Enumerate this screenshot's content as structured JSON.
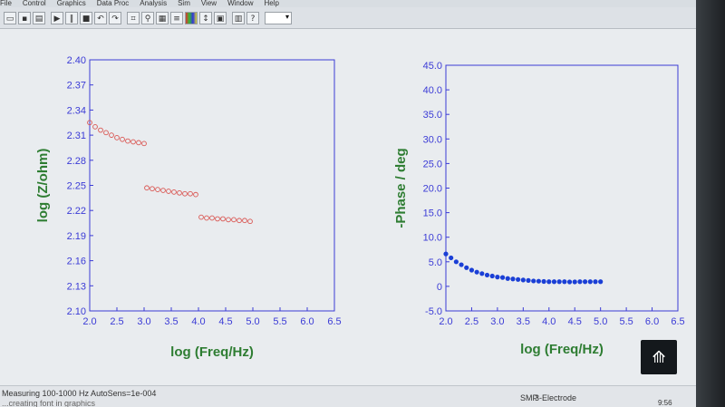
{
  "menu": [
    "File",
    "Control",
    "Graphics",
    "Data Proc",
    "Analysis",
    "Sim",
    "View",
    "Window",
    "Help"
  ],
  "toolbar": {
    "icons": [
      "open-icon",
      "save-icon",
      "print-icon",
      "run-icon",
      "pause-icon",
      "stop-icon",
      "reverse-icon",
      "forward-icon",
      "graph-icon",
      "zoom-icon",
      "chart-icon",
      "overlay-icon",
      "color-bars-icon",
      "axis-icon",
      "settings-icon",
      "grid-icon",
      "help-icon"
    ]
  },
  "chart_data": [
    {
      "type": "scatter",
      "xlabel": "log (Freq/Hz)",
      "ylabel": "log (Z/ohm)",
      "xlim": [
        2.0,
        6.5
      ],
      "ylim": [
        2.1,
        2.4
      ],
      "xticks": [
        "2.0",
        "2.5",
        "3.0",
        "3.5",
        "4.0",
        "4.5",
        "5.0",
        "5.5",
        "6.0",
        "6.5"
      ],
      "yticks": [
        "2.10",
        "2.13",
        "2.16",
        "2.19",
        "2.22",
        "2.25",
        "2.28",
        "2.31",
        "2.34",
        "2.37",
        "2.40"
      ],
      "grid": false,
      "marker": "open-circle",
      "color": "#d9534f",
      "axis_color": "#3b3bd6",
      "label_color": "#2e7d32",
      "x": [
        2.0,
        2.1,
        2.2,
        2.3,
        2.4,
        2.5,
        2.6,
        2.7,
        2.8,
        2.9,
        3.0,
        3.05,
        3.15,
        3.25,
        3.35,
        3.45,
        3.55,
        3.65,
        3.75,
        3.85,
        3.95,
        4.05,
        4.15,
        4.25,
        4.35,
        4.45,
        4.55,
        4.65,
        4.75,
        4.85,
        4.95
      ],
      "y": [
        2.325,
        2.32,
        2.316,
        2.313,
        2.31,
        2.307,
        2.305,
        2.303,
        2.302,
        2.301,
        2.3,
        2.247,
        2.246,
        2.245,
        2.244,
        2.243,
        2.242,
        2.241,
        2.24,
        2.24,
        2.239,
        2.212,
        2.211,
        2.211,
        2.21,
        2.21,
        2.209,
        2.209,
        2.208,
        2.208,
        2.207
      ]
    },
    {
      "type": "scatter",
      "xlabel": "log (Freq/Hz)",
      "ylabel": "-Phase / deg",
      "xlim": [
        2.0,
        6.5
      ],
      "ylim": [
        -5.0,
        45.0
      ],
      "xticks": [
        "2.0",
        "2.5",
        "3.0",
        "3.5",
        "4.0",
        "4.5",
        "5.0",
        "5.5",
        "6.0",
        "6.5"
      ],
      "yticks": [
        "-5.0",
        "0",
        "5.0",
        "10.0",
        "15.0",
        "20.0",
        "25.0",
        "30.0",
        "35.0",
        "40.0",
        "45.0"
      ],
      "grid": false,
      "marker": "filled-circle",
      "color": "#1a3fd6",
      "axis_color": "#3b3bd6",
      "label_color": "#2e7d32",
      "x": [
        2.0,
        2.1,
        2.2,
        2.3,
        2.4,
        2.5,
        2.6,
        2.7,
        2.8,
        2.9,
        3.0,
        3.1,
        3.2,
        3.3,
        3.4,
        3.5,
        3.6,
        3.7,
        3.8,
        3.9,
        4.0,
        4.1,
        4.2,
        4.3,
        4.4,
        4.5,
        4.6,
        4.7,
        4.8,
        4.9,
        5.0
      ],
      "y": [
        6.6,
        5.8,
        5.0,
        4.4,
        3.8,
        3.3,
        2.9,
        2.6,
        2.3,
        2.1,
        1.9,
        1.8,
        1.6,
        1.5,
        1.4,
        1.3,
        1.2,
        1.1,
        1.05,
        1.0,
        0.95,
        0.95,
        0.95,
        0.95,
        0.9,
        0.9,
        0.95,
        0.95,
        0.95,
        0.95,
        0.95
      ]
    }
  ],
  "status": {
    "line1": "Measuring 100-1000 Hz  AutoSens=1e-004",
    "line2": "...creating font in graphics",
    "segment1": "SMP",
    "segment2": "3-Electrode",
    "clock": "9:56"
  },
  "app_icon": "app-triangle-icon"
}
